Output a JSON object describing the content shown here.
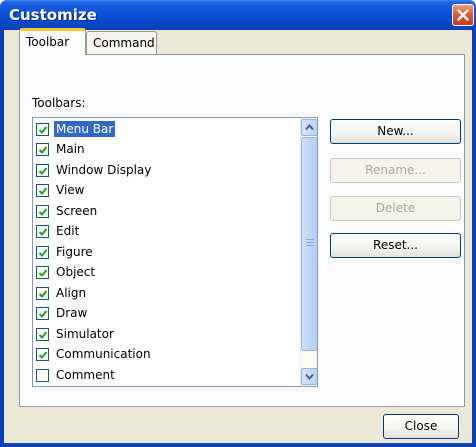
{
  "window": {
    "title": "Customize"
  },
  "tabs": [
    {
      "label": "Toolbar",
      "active": true
    },
    {
      "label": "Command",
      "active": false
    }
  ],
  "toolbars_label": "Toolbars:",
  "toolbars": [
    {
      "label": "Menu Bar",
      "checked": true,
      "selected": true
    },
    {
      "label": "Main",
      "checked": true
    },
    {
      "label": "Window Display",
      "checked": true
    },
    {
      "label": "View",
      "checked": true
    },
    {
      "label": "Screen",
      "checked": true
    },
    {
      "label": "Edit",
      "checked": true
    },
    {
      "label": "Figure",
      "checked": true
    },
    {
      "label": "Object",
      "checked": true
    },
    {
      "label": "Align",
      "checked": true
    },
    {
      "label": "Draw",
      "checked": true
    },
    {
      "label": "Simulator",
      "checked": true
    },
    {
      "label": "Communication",
      "checked": true
    },
    {
      "label": "Comment",
      "checked": false
    }
  ],
  "buttons": {
    "new": "New...",
    "rename": "Rename...",
    "delete": "Delete",
    "reset": "Reset...",
    "close": "Close"
  },
  "colors": {
    "titlebar": "#0a50d8",
    "selection": "#316ac5",
    "check": "#21a121",
    "dialog_bg": "#ece9d8"
  },
  "icons": {
    "close": "close-x-icon",
    "check": "checkmark-icon",
    "scroll_up": "chevron-up-icon",
    "scroll_down": "chevron-down-icon"
  }
}
